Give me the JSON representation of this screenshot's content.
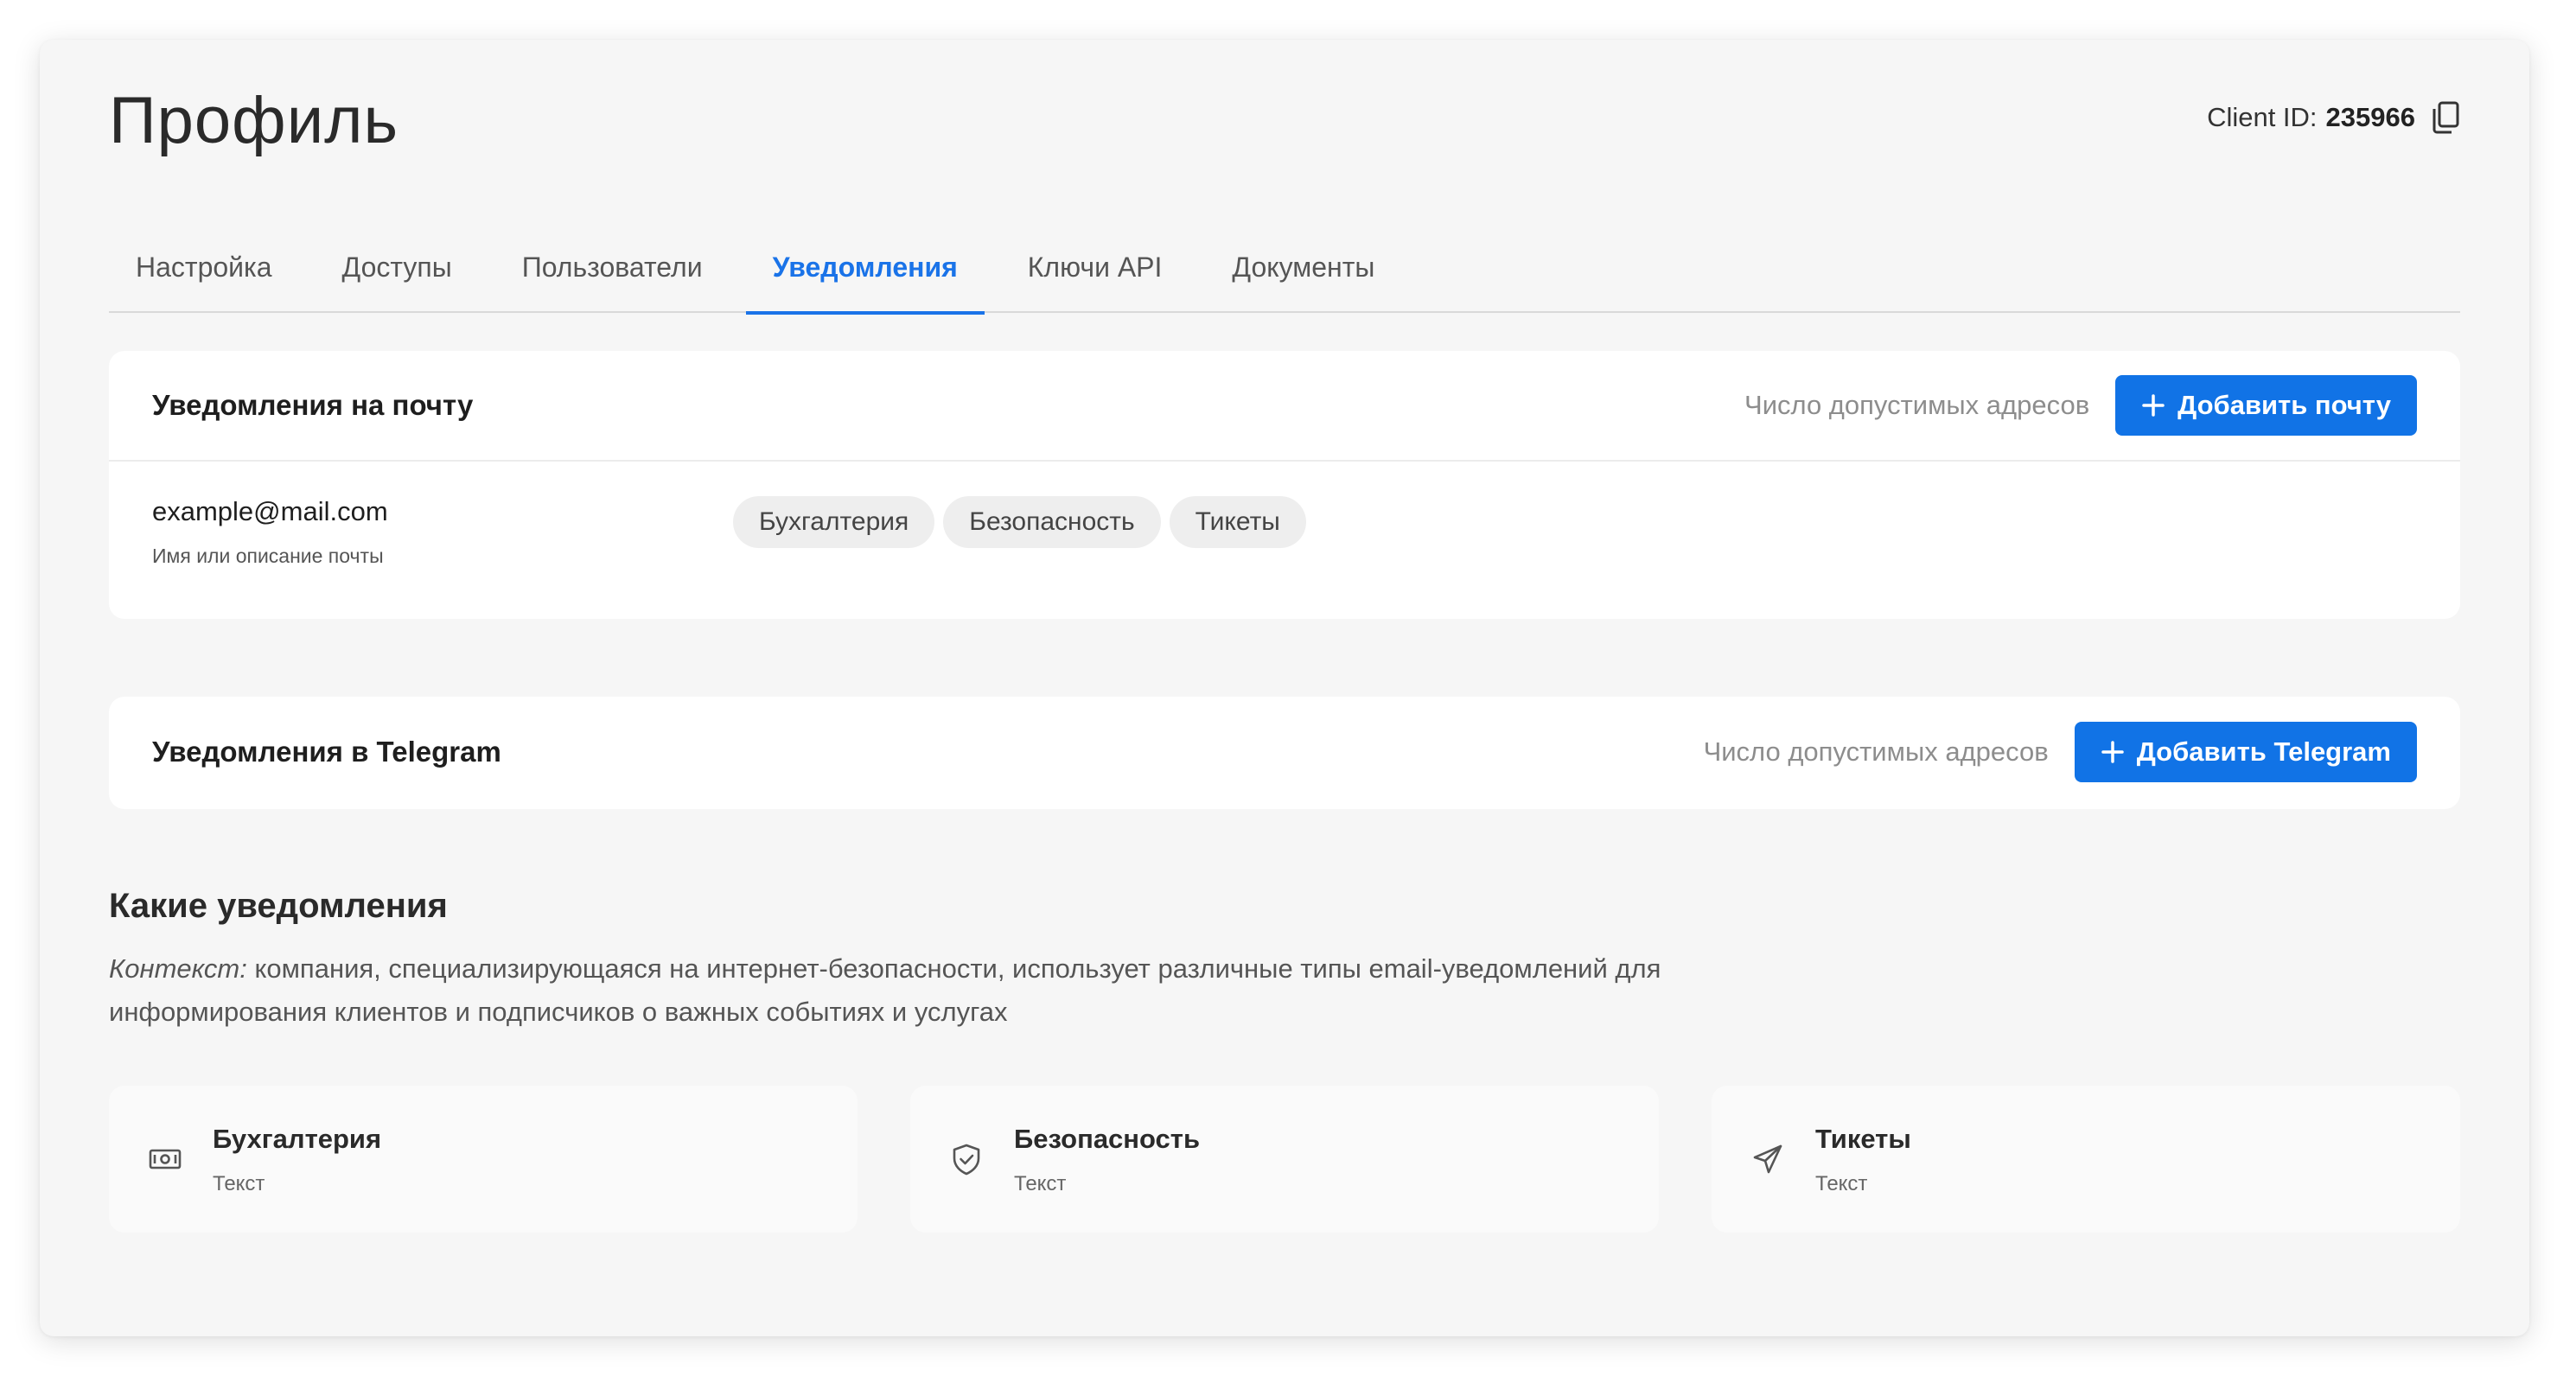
{
  "header": {
    "title": "Профиль",
    "client_id_label": "Client ID:",
    "client_id_value": "235966"
  },
  "tabs": [
    {
      "label": "Настройка",
      "active": false
    },
    {
      "label": "Доступы",
      "active": false
    },
    {
      "label": "Пользователи",
      "active": false
    },
    {
      "label": "Уведомления",
      "active": true
    },
    {
      "label": "Ключи API",
      "active": false
    },
    {
      "label": "Документы",
      "active": false
    }
  ],
  "email_section": {
    "title": "Уведомления на почту",
    "hint": "Число допустимых адресов",
    "add_button": "Добавить почту",
    "entries": [
      {
        "email": "example@mail.com",
        "description": "Имя или описание почты",
        "tags": [
          "Бухгалтерия",
          "Безопасность",
          "Тикеты"
        ]
      }
    ]
  },
  "telegram_section": {
    "title": "Уведомления в Telegram",
    "hint": "Число допустимых адресов",
    "add_button": "Добавить Telegram"
  },
  "types_section": {
    "title": "Какие уведомления",
    "context_label": "Контекст:",
    "context_text": " компания, специализирующаяся на интернет-безопасности, использует различные типы email-уведомлений для информирования клиентов и подписчиков о важных событиях и услугах",
    "cards": [
      {
        "title": "Бухгалтерия",
        "subtitle": "Текст",
        "icon": "money-icon"
      },
      {
        "title": "Безопасность",
        "subtitle": "Текст",
        "icon": "shield-check-icon"
      },
      {
        "title": "Тикеты",
        "subtitle": "Текст",
        "icon": "send-icon"
      }
    ]
  },
  "colors": {
    "accent": "#1173e6",
    "background": "#f6f6f6",
    "card": "#ffffff"
  }
}
